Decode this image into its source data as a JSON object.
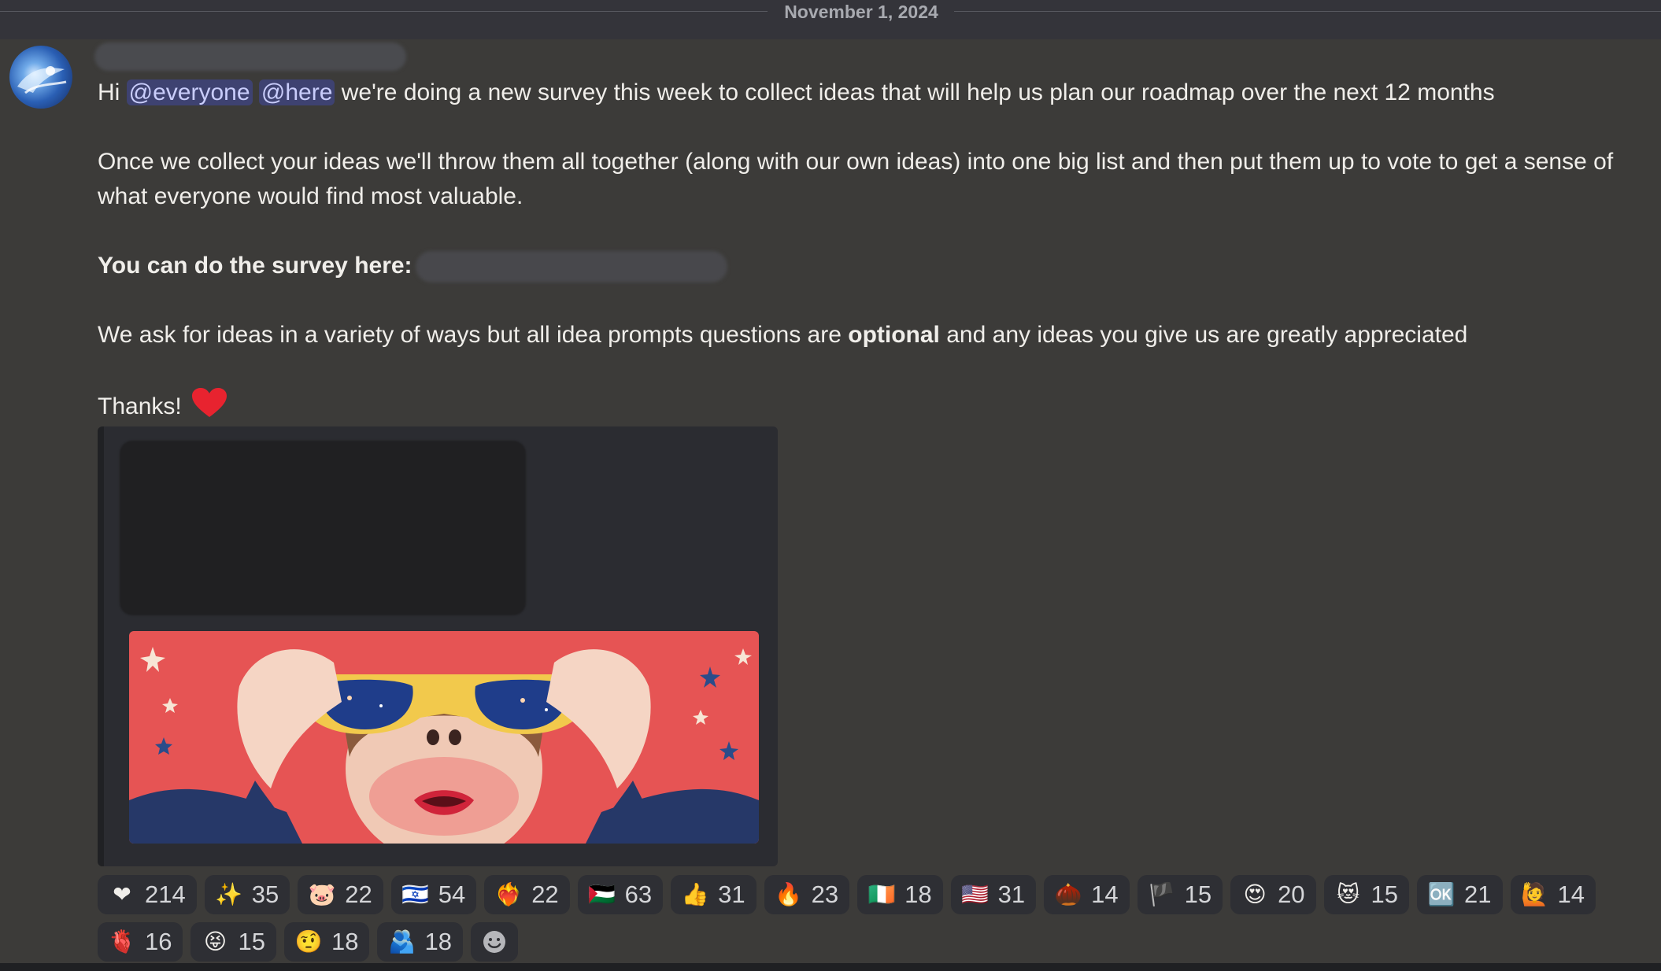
{
  "date_divider": "November 1, 2024",
  "message": {
    "line1_prefix": "Hi ",
    "mention_everyone": "@everyone",
    "mention_here": "@here",
    "line1_suffix": " we're doing a new survey this week to collect ideas that will help us plan our roadmap over the next 12 months",
    "para2": "Once we collect your ideas we'll throw them all together (along with our own ideas) into one big list and then put them up to vote to get a sense of what everyone would find most valuable.",
    "survey_label": "You can do the survey here:",
    "para4_prefix": "We ask for ideas in a variety of ways but all idea prompts questions are ",
    "para4_bold": "optional",
    "para4_suffix": " and any ideas you give us are greatly appreciated",
    "thanks": "Thanks!"
  },
  "colors": {
    "background": "#3c3b39",
    "mention_bg": "#3e4271",
    "mention_text": "#c9cdfb",
    "reaction_bg": "#2e2f34",
    "heart": "#e8232f"
  },
  "reactions_row1": [
    {
      "icon": "red-heart-icon",
      "glyph": "❤",
      "count": "214"
    },
    {
      "icon": "sparkles-icon",
      "glyph": "✨",
      "count": "35"
    },
    {
      "icon": "pig-face-icon",
      "glyph": "🐷",
      "count": "22"
    },
    {
      "icon": "israel-flag-icon",
      "glyph": "🇮🇱",
      "count": "54"
    },
    {
      "icon": "heart-on-fire-icon",
      "glyph": "❤‍🔥",
      "count": "22"
    },
    {
      "icon": "palestine-flag-icon",
      "glyph": "🇵🇸",
      "count": "63"
    },
    {
      "icon": "thumbs-up-icon",
      "glyph": "👍",
      "count": "31"
    },
    {
      "icon": "fire-icon",
      "glyph": "🔥",
      "count": "23"
    },
    {
      "icon": "ireland-flag-icon",
      "glyph": "🇮🇪",
      "count": "18"
    },
    {
      "icon": "us-flag-icon",
      "glyph": "🇺🇸",
      "count": "31"
    },
    {
      "icon": "custom-emoji-icon",
      "glyph": "🌰",
      "count": "14"
    },
    {
      "icon": "wales-flag-icon",
      "glyph": "🏴",
      "count": "15"
    },
    {
      "icon": "heart-eyes-icon",
      "glyph": "😍",
      "count": "20"
    },
    {
      "icon": "heart-eyes-cat-icon",
      "glyph": "😻",
      "count": "15"
    },
    {
      "icon": "ok-button-icon",
      "glyph": "🆗",
      "count": "21"
    },
    {
      "icon": "person-raising-hand-icon",
      "glyph": "🙋",
      "count": "14"
    }
  ],
  "reactions_row2": [
    {
      "icon": "anatomical-heart-icon",
      "glyph": "🫀",
      "count": "16"
    },
    {
      "icon": "custom-face-icon",
      "glyph": "😝",
      "count": "15"
    },
    {
      "icon": "face-with-raised-eyebrow-icon",
      "glyph": "🤨",
      "count": "18"
    },
    {
      "icon": "people-hugging-icon",
      "glyph": "🫂",
      "count": "18"
    }
  ],
  "add_reaction": {
    "icon": "add-reaction-icon"
  }
}
